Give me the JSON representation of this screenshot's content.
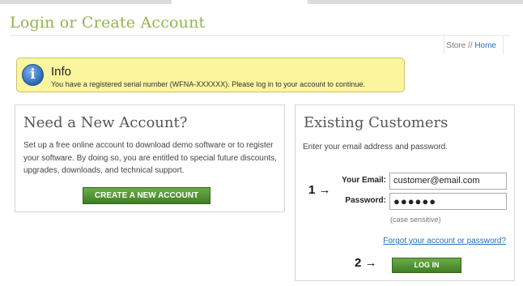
{
  "page": {
    "title": "Login or Create Account"
  },
  "breadcrumb": {
    "store": "Store",
    "separator": "//",
    "home": "Home"
  },
  "info_box": {
    "icon": "info-icon",
    "icon_glyph": "i",
    "title": "Info",
    "message": "You have a registered serial number  (WFNA-XXXXXX). Please log in to your account to continue."
  },
  "new_account": {
    "heading": "Need a New Account?",
    "text": "Set up a free online account to download demo software or to register your software. By doing so, you are entitled to special future discounts, upgrades, downloads, and technical support.",
    "button_label": "CREATE A NEW ACCOUNT"
  },
  "existing_customers": {
    "heading": "Existing Customers",
    "intro": "Enter your email address and password.",
    "email_label": "Your Email:",
    "email_value": "customer@email.com",
    "password_label": "Password:",
    "password_value": "●●●●●●",
    "case_note": "(case sensitive)",
    "forgot_link": "Forgot your account or password?",
    "login_button": "LOG IN"
  },
  "annotations": {
    "step1": "1 →",
    "step2": "2 →"
  },
  "colors": {
    "title_green": "#8fb64a",
    "button_green": "#4f8f31",
    "info_yellow": "#fbf59e",
    "link_blue": "#2a6bb3"
  }
}
